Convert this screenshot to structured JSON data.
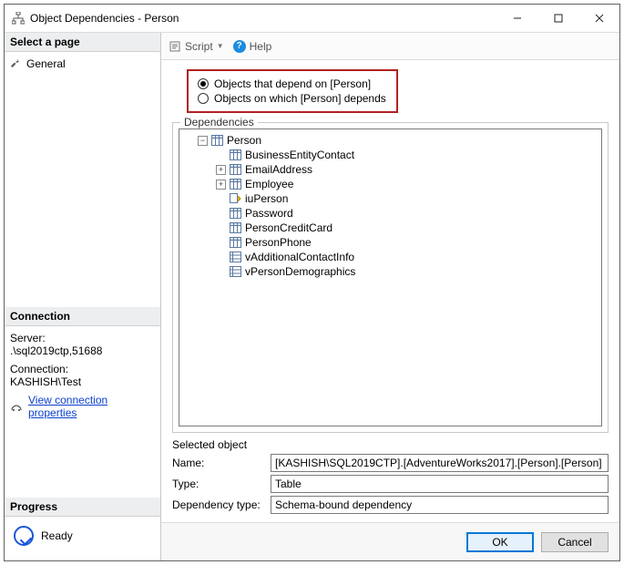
{
  "window": {
    "title": "Object Dependencies - Person"
  },
  "left": {
    "select_page": "Select a page",
    "general": "General",
    "connection_head": "Connection",
    "server_label": "Server:",
    "server_value": ".\\sql2019ctp,51688",
    "conn_label": "Connection:",
    "conn_value": "KASHISH\\Test",
    "view_conn": "View connection properties",
    "progress_head": "Progress",
    "progress_status": "Ready"
  },
  "toolbar": {
    "script": "Script",
    "help": "Help"
  },
  "radios": {
    "opt1": "Objects that depend on [Person]",
    "opt2": "Objects on which [Person] depends"
  },
  "deps": {
    "legend": "Dependencies",
    "root": "Person",
    "children": {
      "c0": "BusinessEntityContact",
      "c1": "EmailAddress",
      "c2": "Employee",
      "c3": "iuPerson",
      "c4": "Password",
      "c5": "PersonCreditCard",
      "c6": "PersonPhone",
      "c7": "vAdditionalContactInfo",
      "c8": "vPersonDemographics"
    }
  },
  "details": {
    "selected_label": "Selected object",
    "name_label": "Name:",
    "name_value": "[KASHISH\\SQL2019CTP].[AdventureWorks2017].[Person].[Person]",
    "type_label": "Type:",
    "type_value": "Table",
    "deptype_label": "Dependency type:",
    "deptype_value": "Schema-bound dependency"
  },
  "footer": {
    "ok": "OK",
    "cancel": "Cancel"
  }
}
